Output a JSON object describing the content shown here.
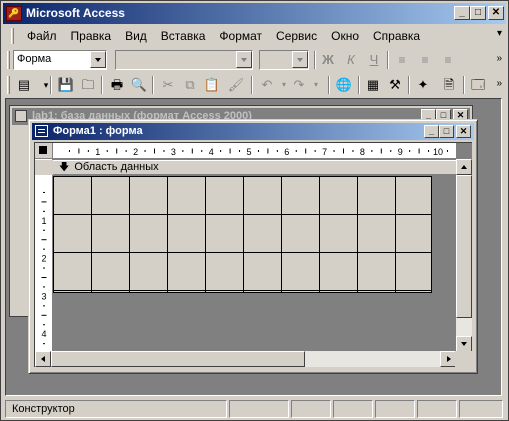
{
  "app": {
    "title": "Microsoft Access",
    "icon": "access-key-icon"
  },
  "menu": [
    "Файл",
    "Правка",
    "Вид",
    "Вставка",
    "Формат",
    "Сервис",
    "Окно",
    "Справка"
  ],
  "toolbar1": {
    "object_combo": "Форма"
  },
  "db_window": {
    "title": "lab1: база данных (формат Access 2000)"
  },
  "form_window": {
    "title": "Форма1 : форма",
    "section_label": "Область данных",
    "h_ruler": [
      "1",
      "2",
      "3",
      "4",
      "5",
      "6",
      "7",
      "8",
      "9",
      "10"
    ],
    "v_ruler": [
      "1",
      "2",
      "3",
      "4"
    ]
  },
  "status": {
    "mode": "Конструктор"
  },
  "colors": {
    "title_active_start": "#0a246a",
    "title_active_end": "#a6caf0",
    "face": "#d4d0c8",
    "mdi_bg": "#808080"
  }
}
